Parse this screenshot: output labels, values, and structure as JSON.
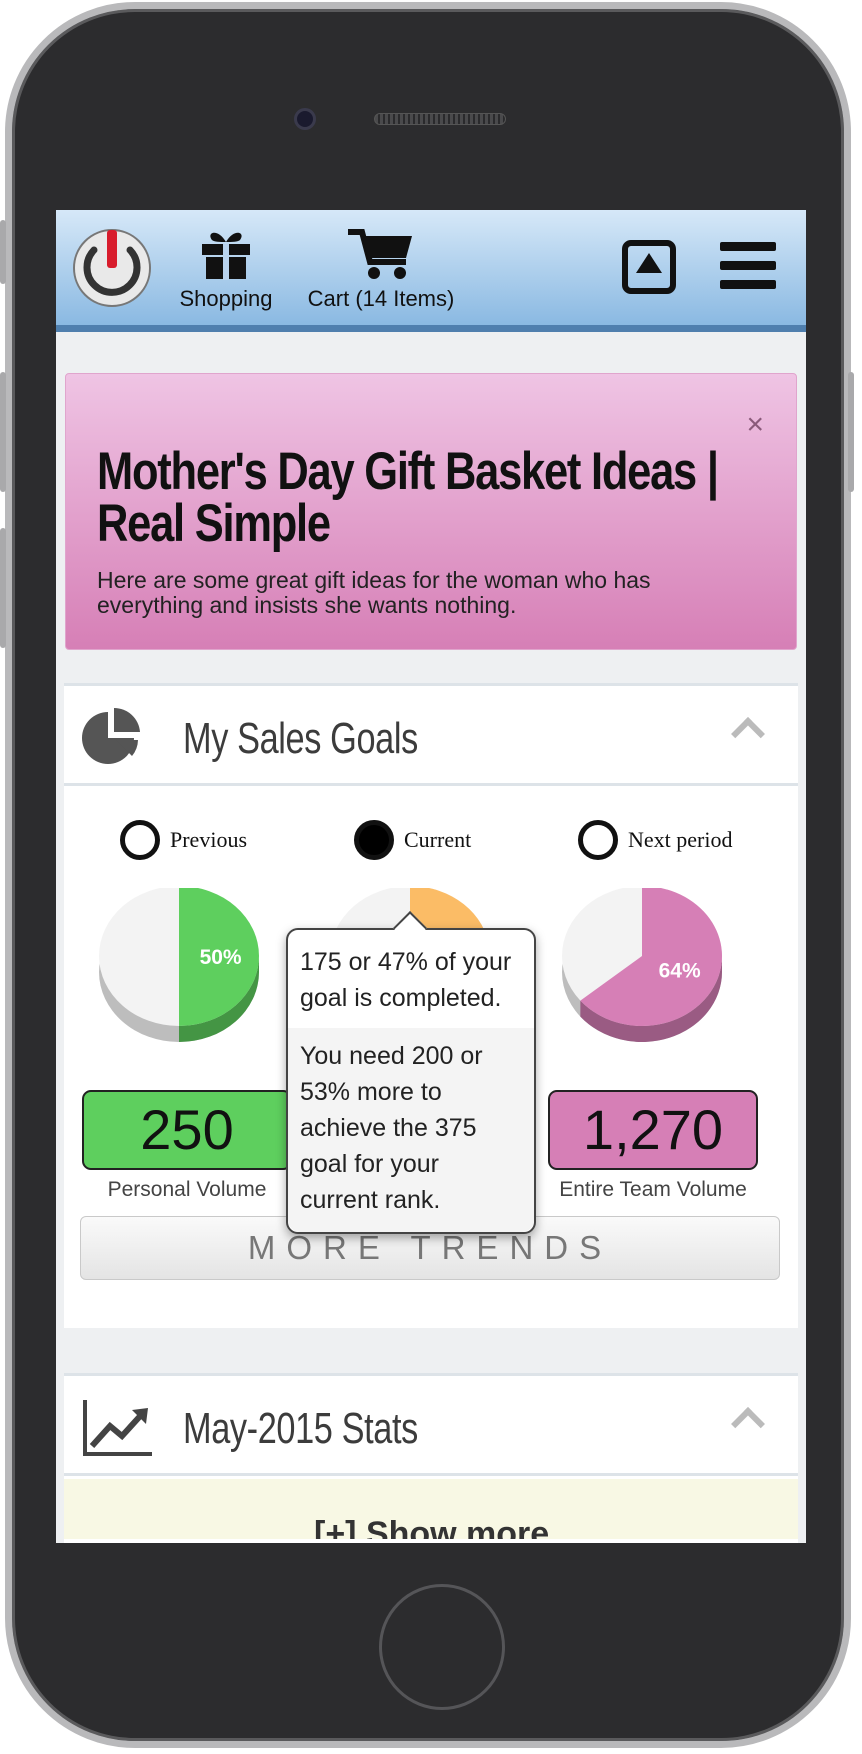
{
  "topbar": {
    "nav": [
      {
        "label": "Shopping",
        "icon": "gift-icon"
      },
      {
        "label": "Cart (14 Items)",
        "icon": "cart-icon"
      }
    ],
    "icons": [
      "power-icon",
      "upload-icon",
      "menu-icon"
    ]
  },
  "promo": {
    "title": "Mother's Day Gift Basket Ideas | Real Simple",
    "text": "Here are some great gift ideas for the woman who has everything and insists she wants nothing.",
    "close": "×",
    "colors": {
      "top": "#efc4e4",
      "bottom": "#d67fb6"
    }
  },
  "sales_goals": {
    "title": "My Sales Goals",
    "periods": [
      {
        "label": "Previous",
        "selected": false
      },
      {
        "label": "Current",
        "selected": true
      },
      {
        "label": "Next period",
        "selected": false
      }
    ],
    "pies": [
      {
        "percent": 50,
        "label": "50%",
        "color": "#5ecf5e"
      },
      {
        "percent": 47,
        "label": "",
        "color": "#fbbc66"
      },
      {
        "percent": 64,
        "label": "64%",
        "color": "#d67fb6"
      }
    ],
    "volumes": [
      {
        "value": "250",
        "label": "Personal Volume",
        "color": "#5ecf5e"
      },
      {
        "value": "",
        "label": "",
        "color": "#fbbc66"
      },
      {
        "value": "1,270",
        "label": "Entire Team Volume",
        "color": "#d67fb6"
      }
    ],
    "tooltip": {
      "line1": "175 or 47% of your goal is completed.",
      "line2": "You need 200 or 53% more to achieve the 375 goal for your current rank."
    },
    "more_button": "MORE TRENDS"
  },
  "stats": {
    "title": "May-2015 Stats",
    "show_more": "[+] Show more"
  }
}
